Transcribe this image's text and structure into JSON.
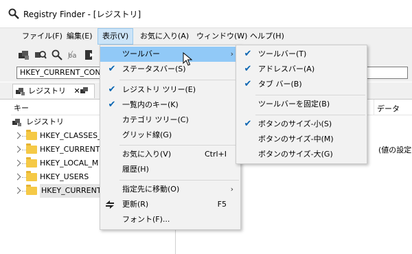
{
  "window": {
    "title": "Registry Finder - [レジストリ]"
  },
  "menubar": {
    "items": [
      "ファイル(F)",
      "編集(E)",
      "表示(V)",
      "お気に入り(A)",
      "ウィンドウ(W)",
      "ヘルプ(H)"
    ]
  },
  "address": {
    "value": "HKEY_CURRENT_CON"
  },
  "tabs": [
    {
      "label": "レジストリ",
      "close": "✕"
    }
  ],
  "tree": {
    "header_key": "キー",
    "root": "レジストリ",
    "items": [
      "HKEY_CLASSES_",
      "HKEY_CURRENT",
      "HKEY_LOCAL_M",
      "HKEY_USERS",
      "HKEY_CURRENT"
    ]
  },
  "right": {
    "data_header": "データ",
    "value_text": "(値の設定"
  },
  "view_menu": {
    "items": [
      {
        "label": "ツールバー",
        "check": "",
        "shortcut": "",
        "arrow": "›"
      },
      {
        "label": "ステータスバー(S)",
        "check": "✔",
        "shortcut": "",
        "arrow": ""
      },
      {
        "label": "レジストリ ツリー(E)",
        "check": "✔",
        "shortcut": "",
        "arrow": ""
      },
      {
        "label": "一覧内のキー(K)",
        "check": "✔",
        "shortcut": "",
        "arrow": ""
      },
      {
        "label": "カテゴリ ツリー(C)",
        "check": "",
        "shortcut": "",
        "arrow": ""
      },
      {
        "label": "グリッド線(G)",
        "check": "",
        "shortcut": "",
        "arrow": ""
      },
      {
        "label": "お気に入り(V)",
        "check": "",
        "shortcut": "Ctrl+I",
        "arrow": ""
      },
      {
        "label": "履歴(H)",
        "check": "",
        "shortcut": "",
        "arrow": ""
      },
      {
        "label": "指定先に移動(O)",
        "check": "",
        "shortcut": "",
        "arrow": "›"
      },
      {
        "label": "更新(R)",
        "check": "",
        "shortcut": "F5",
        "arrow": ""
      },
      {
        "label": "フォント(F)...",
        "check": "",
        "shortcut": "",
        "arrow": ""
      }
    ]
  },
  "toolbar_submenu": {
    "items": [
      {
        "label": "ツールバー(T)",
        "check": "✔"
      },
      {
        "label": "アドレスバー(A)",
        "check": "✔"
      },
      {
        "label": "タブ バー(B)",
        "check": "✔"
      },
      {
        "label": "ツールバーを固定(B)",
        "check": ""
      },
      {
        "label": "ボタンのサイズ-小(S)",
        "check": "✔"
      },
      {
        "label": "ボタンのサイズ-中(M)",
        "check": ""
      },
      {
        "label": "ボタンのサイズ-大(G)",
        "check": ""
      }
    ]
  },
  "colors": {
    "hover": "#91c9f7",
    "check": "#0063b1",
    "menu_bg": "#f2f2f2",
    "folder": "#f5c946"
  }
}
